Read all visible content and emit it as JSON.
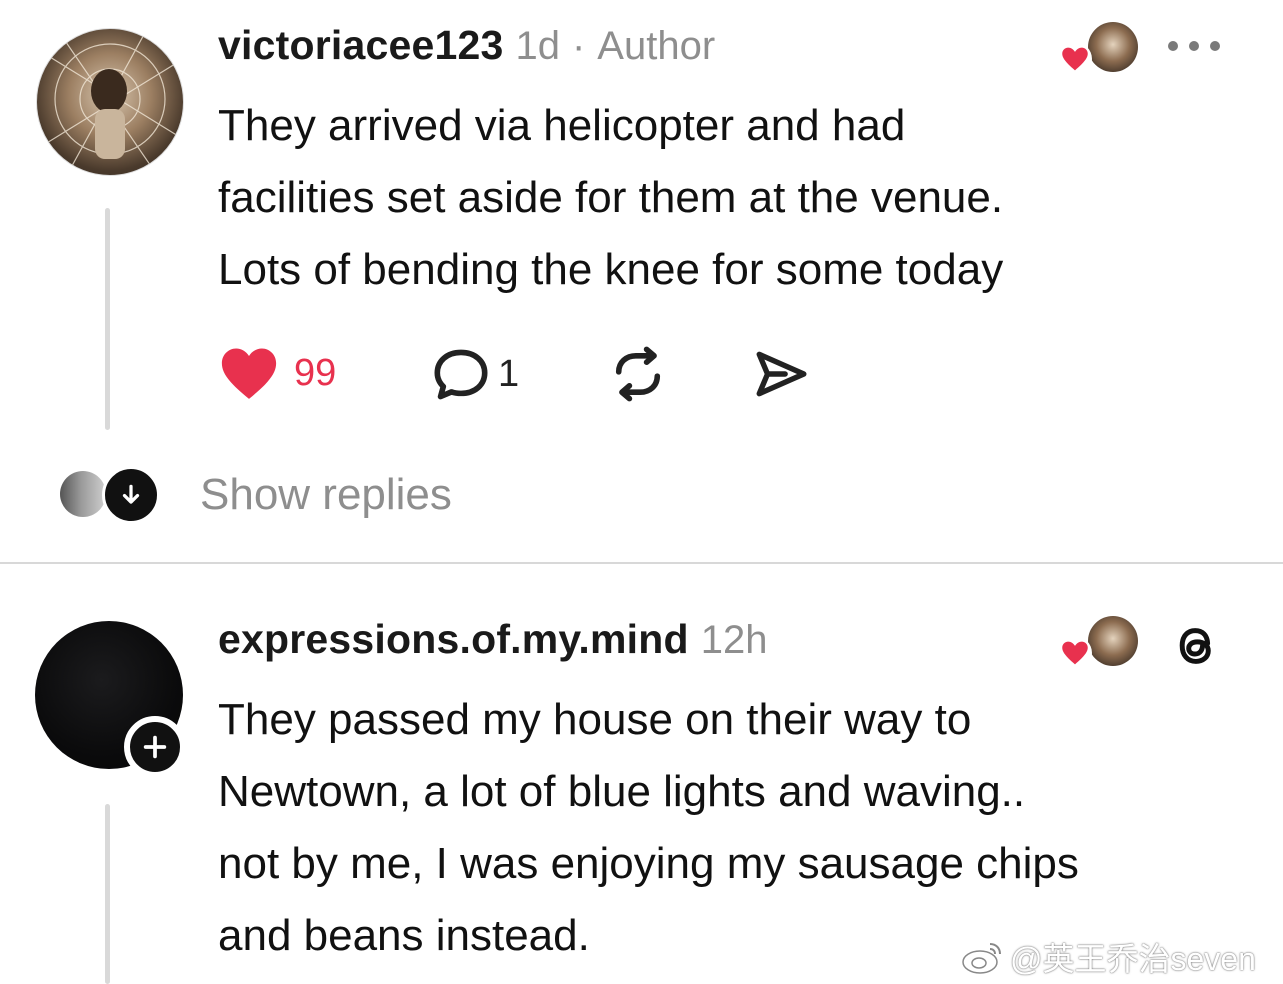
{
  "comments": [
    {
      "username": "victoriacee123",
      "time": "1d",
      "separator": "·",
      "tag": "Author",
      "text_lines": [
        "They arrived via helicopter and had",
        "facilities set aside for them at the venue.",
        "Lots of bending the knee for some today"
      ],
      "likes": "99",
      "replies": "1",
      "liked": true
    },
    {
      "username": "expressions.of.my.mind",
      "time": "12h",
      "text_lines": [
        "They passed my house on their way to",
        "Newtown, a lot of blue lights and waving..",
        "not by me, I was enjoying my sausage chips",
        "and beans instead."
      ]
    }
  ],
  "show_replies_label": "Show replies",
  "watermark": "@英王乔治seven",
  "colors": {
    "like_red": "#e8314e",
    "meta_gray": "#8e8e8e",
    "divider": "#d8d8d8"
  },
  "icons": [
    "heart-icon",
    "comment-icon",
    "repost-icon",
    "share-icon",
    "more-icon",
    "threads-logo-icon",
    "plus-icon",
    "arrow-down-icon",
    "weibo-icon"
  ]
}
